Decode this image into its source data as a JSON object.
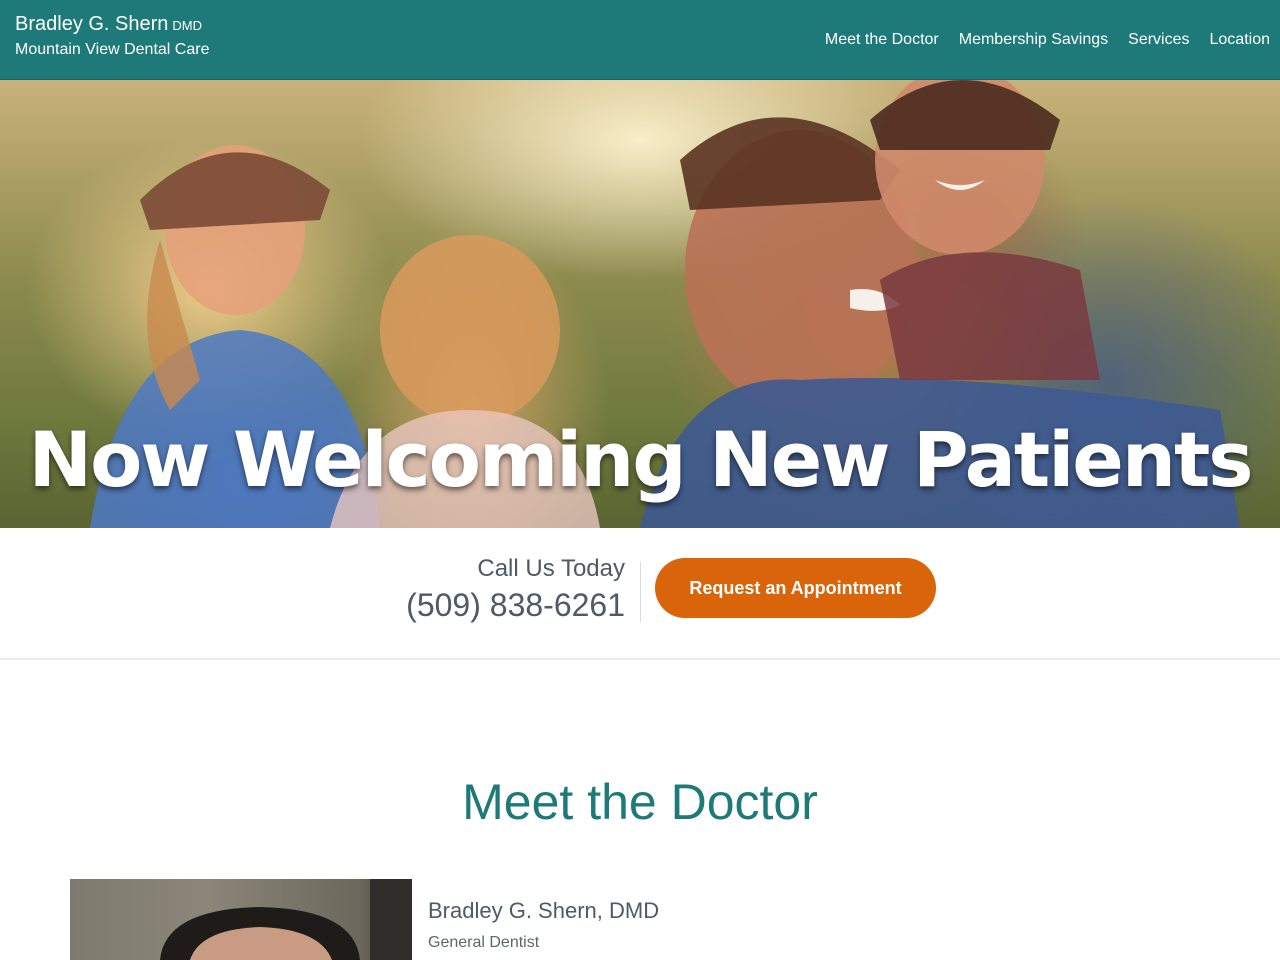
{
  "header": {
    "brand_name": "Bradley G. Shern",
    "brand_credential": "DMD",
    "brand_practice": "Mountain View Dental Care",
    "nav": [
      {
        "label": "Meet the Doctor"
      },
      {
        "label": "Membership Savings"
      },
      {
        "label": "Services"
      },
      {
        "label": "Location"
      }
    ],
    "color": "#1d7a78"
  },
  "hero": {
    "headline": "Now Welcoming New Patients"
  },
  "cta": {
    "call_label": "Call Us Today",
    "phone": "(509) 838-6261",
    "button_label": "Request an Appointment",
    "button_color": "#d9640a"
  },
  "doctor_section": {
    "title": "Meet the Doctor",
    "name": "Bradley G. Shern, DMD",
    "role": "General Dentist"
  }
}
